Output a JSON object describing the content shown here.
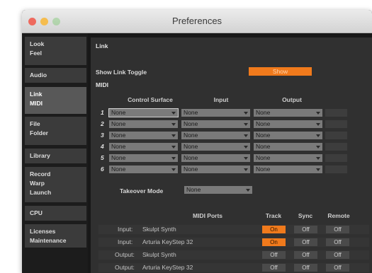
{
  "window": {
    "title": "Preferences"
  },
  "sidebar": {
    "tabs": [
      {
        "lines": [
          "Look",
          "Feel"
        ]
      },
      {
        "lines": [
          "Audio"
        ]
      },
      {
        "lines": [
          "Link",
          "MIDI"
        ]
      },
      {
        "lines": [
          "File",
          "Folder"
        ]
      },
      {
        "lines": [
          "Library"
        ]
      },
      {
        "lines": [
          "Record",
          "Warp",
          "Launch"
        ]
      },
      {
        "lines": [
          "CPU"
        ]
      },
      {
        "lines": [
          "Licenses",
          "Maintenance"
        ]
      }
    ]
  },
  "link": {
    "section_title": "Link",
    "show_toggle_label": "Show Link Toggle",
    "show_toggle_value": "Show"
  },
  "midi": {
    "section_title": "MIDI",
    "headers": {
      "control_surface": "Control Surface",
      "input": "Input",
      "output": "Output"
    },
    "rows": [
      {
        "num": "1",
        "cs": "None",
        "input": "None",
        "output": "None"
      },
      {
        "num": "2",
        "cs": "None",
        "input": "None",
        "output": "None"
      },
      {
        "num": "3",
        "cs": "None",
        "input": "None",
        "output": "None"
      },
      {
        "num": "4",
        "cs": "None",
        "input": "None",
        "output": "None"
      },
      {
        "num": "5",
        "cs": "None",
        "input": "None",
        "output": "None"
      },
      {
        "num": "6",
        "cs": "None",
        "input": "None",
        "output": "None"
      }
    ],
    "takeover_label": "Takeover Mode",
    "takeover_value": "None"
  },
  "ports": {
    "header": "MIDI Ports",
    "col_track": "Track",
    "col_sync": "Sync",
    "col_remote": "Remote",
    "rows": [
      {
        "direction": "Input:",
        "name": "Skulpt Synth",
        "track": "On",
        "sync": "Off",
        "remote": "Off"
      },
      {
        "direction": "Input:",
        "name": "Arturia KeyStep 32",
        "track": "On",
        "sync": "Off",
        "remote": "Off"
      },
      {
        "direction": "Output:",
        "name": "Skulpt Synth",
        "track": "Off",
        "sync": "Off",
        "remote": "Off"
      },
      {
        "direction": "Output:",
        "name": "Arturia KeyStep 32",
        "track": "Off",
        "sync": "Off",
        "remote": "Off"
      }
    ]
  },
  "colors": {
    "accent": "#f07a1c",
    "close": "#ee6a5e",
    "minimize": "#f5bd4f",
    "zoom": "#61c454"
  }
}
